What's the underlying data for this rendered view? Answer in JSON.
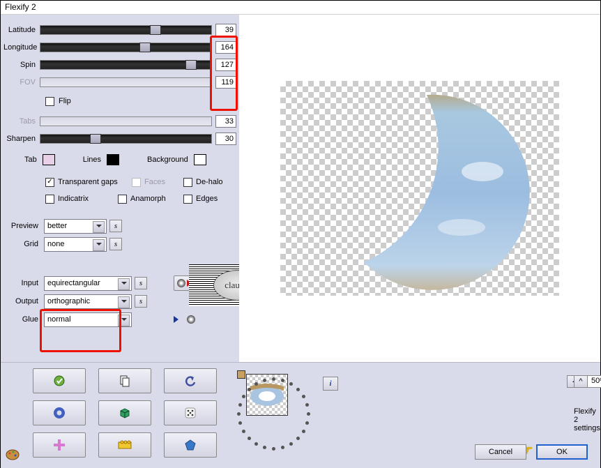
{
  "window": {
    "title": "Flexify 2"
  },
  "sliders": {
    "latitude": {
      "label": "Latitude",
      "value": "39",
      "pos": 64
    },
    "longitude": {
      "label": "Longitude",
      "value": "164",
      "pos": 58
    },
    "spin": {
      "label": "Spin",
      "value": "127",
      "pos": 85
    },
    "fov": {
      "label": "FOV",
      "value": "119",
      "pos": 2,
      "disabled": true
    },
    "tabs": {
      "label": "Tabs",
      "value": "33",
      "pos": 2,
      "gray": true
    },
    "sharpen": {
      "label": "Sharpen",
      "value": "30",
      "pos": 29
    }
  },
  "flip": {
    "label": "Flip",
    "checked": false
  },
  "swatches": {
    "tab": {
      "label": "Tab"
    },
    "lines": {
      "label": "Lines"
    },
    "bg": {
      "label": "Background"
    }
  },
  "options": {
    "transparent_gaps": {
      "label": "Transparent gaps",
      "checked": true
    },
    "faces": {
      "label": "Faces",
      "checked": false,
      "disabled": true
    },
    "dehalo": {
      "label": "De-halo",
      "checked": false
    },
    "indicatrix": {
      "label": "Indicatrix",
      "checked": false
    },
    "anamorph": {
      "label": "Anamorph",
      "checked": false
    },
    "edges": {
      "label": "Edges",
      "checked": false
    }
  },
  "dropdowns": {
    "preview": {
      "label": "Preview",
      "value": "better"
    },
    "grid": {
      "label": "Grid",
      "value": "none"
    },
    "input": {
      "label": "Input",
      "value": "equirectangular"
    },
    "output": {
      "label": "Output",
      "value": "orthographic"
    },
    "glue": {
      "label": "Glue",
      "value": "normal"
    }
  },
  "watermark": "claudia",
  "zoom": {
    "minus": "-",
    "value": "50%",
    "plus": "+"
  },
  "footer": {
    "settings": "Flexify 2 settings",
    "cancel": "Cancel",
    "ok": "OK",
    "info": "i",
    "caret": "^"
  }
}
